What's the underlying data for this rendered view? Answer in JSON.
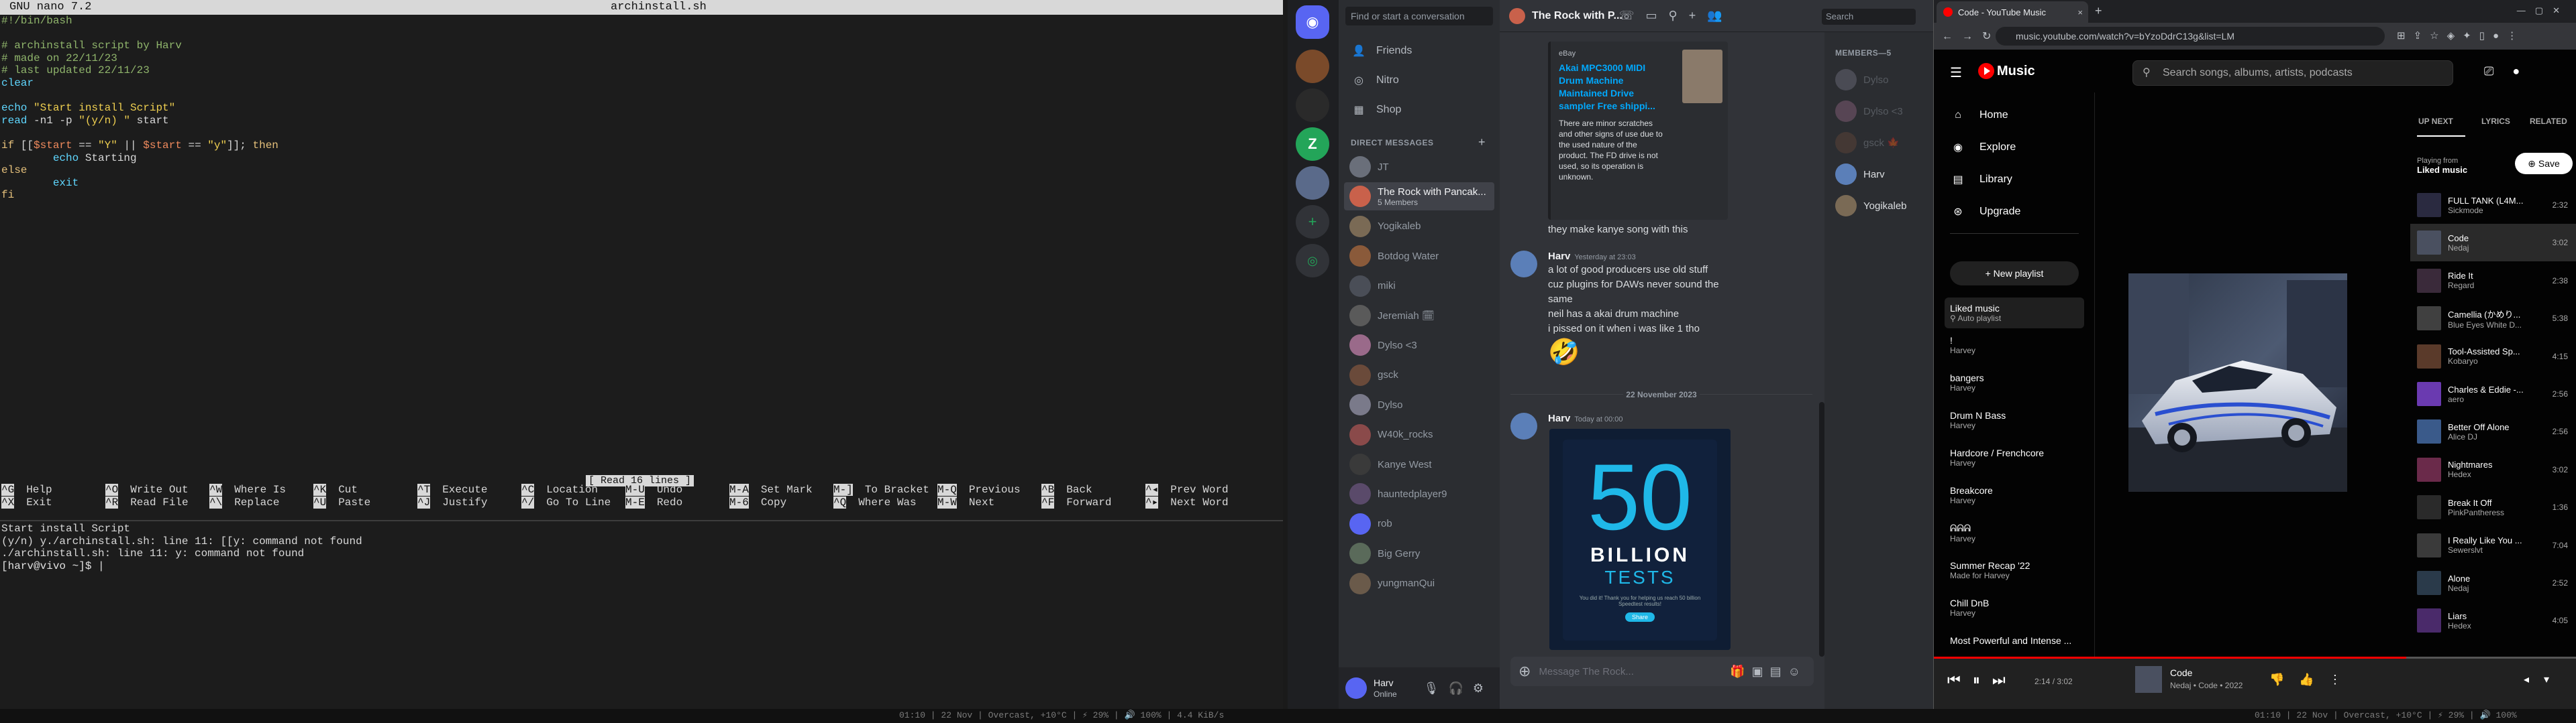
{
  "nano": {
    "version": "GNU nano 7.2",
    "filename": "archinstall.sh",
    "lines": [
      [
        [
          "c-shebang",
          "#!/bin/bash"
        ]
      ],
      [
        [
          "c-plain",
          ""
        ]
      ],
      [
        [
          "c-comment",
          "# archinstall script by Harv"
        ]
      ],
      [
        [
          "c-comment",
          "# made on 22/11/23"
        ]
      ],
      [
        [
          "c-comment",
          "# last updated 22/11/23"
        ]
      ],
      [
        [
          "c-kw",
          "clear"
        ]
      ],
      [
        [
          "c-plain",
          ""
        ]
      ],
      [
        [
          "c-kw",
          "echo "
        ],
        [
          "c-str",
          "\"Start install Script\""
        ]
      ],
      [
        [
          "c-kw",
          "read"
        ],
        [
          "c-plain",
          " -n1 -p "
        ],
        [
          "c-str",
          "\"(y/n) \""
        ],
        [
          "c-plain",
          " start"
        ]
      ],
      [
        [
          "c-plain",
          ""
        ]
      ],
      [
        [
          "c-kw2",
          "if"
        ],
        [
          "c-plain",
          " [["
        ],
        [
          "c-var",
          "$start"
        ],
        [
          "c-plain",
          " == "
        ],
        [
          "c-str",
          "\"Y\""
        ],
        [
          "c-plain",
          " || "
        ],
        [
          "c-var",
          "$start"
        ],
        [
          "c-plain",
          " == "
        ],
        [
          "c-str",
          "\"y\""
        ],
        [
          "c-plain",
          "]]; "
        ],
        [
          "c-kw2",
          "then"
        ]
      ],
      [
        [
          "c-plain",
          "        "
        ],
        [
          "c-kw",
          "echo"
        ],
        [
          "c-plain",
          " Starting"
        ]
      ],
      [
        [
          "c-kw2",
          "else"
        ]
      ],
      [
        [
          "c-plain",
          "        "
        ],
        [
          "c-kw",
          "exit"
        ]
      ],
      [
        [
          "c-kw2",
          "fi"
        ]
      ]
    ],
    "status_message": "[ Read 16 lines ]",
    "help": [
      {
        "key": "^G",
        "label": "Help"
      },
      {
        "key": "^O",
        "label": "Write Out"
      },
      {
        "key": "^W",
        "label": "Where Is"
      },
      {
        "key": "^K",
        "label": "Cut"
      },
      {
        "key": "^T",
        "label": "Execute"
      },
      {
        "key": "^C",
        "label": "Location"
      },
      {
        "key": "M-U",
        "label": "Undo"
      },
      {
        "key": "M-A",
        "label": "Set Mark"
      },
      {
        "key": "M-]",
        "label": "To Bracket"
      },
      {
        "key": "M-Q",
        "label": "Previous"
      },
      {
        "key": "^B",
        "label": "Back"
      },
      {
        "key": "^◂",
        "label": "Prev Word"
      },
      {
        "key": "^X",
        "label": "Exit"
      },
      {
        "key": "^R",
        "label": "Read File"
      },
      {
        "key": "^\\",
        "label": "Replace"
      },
      {
        "key": "^U",
        "label": "Paste"
      },
      {
        "key": "^J",
        "label": "Justify"
      },
      {
        "key": "^/",
        "label": "Go To Line"
      },
      {
        "key": "M-E",
        "label": "Redo"
      },
      {
        "key": "M-6",
        "label": "Copy"
      },
      {
        "key": "^Q",
        "label": "Where Was"
      },
      {
        "key": "M-W",
        "label": "Next"
      },
      {
        "key": "^F",
        "label": "Forward"
      },
      {
        "key": "^▸",
        "label": "Next Word"
      }
    ]
  },
  "shell": {
    "lines": [
      "Start install Script",
      "(y/n) y./archinstall.sh: line 11: [[y: command not found",
      "./archinstall.sh: line 11: y: command not found"
    ],
    "prompt": "[harv@vivo ~]$ |"
  },
  "discord": {
    "search_placeholder": "Find or start a conversation",
    "nav": [
      {
        "icon": "friends-icon",
        "glyph": "👤",
        "label": "Friends"
      },
      {
        "icon": "nitro-icon",
        "glyph": "◎",
        "label": "Nitro"
      },
      {
        "icon": "shop-icon",
        "glyph": "▦",
        "label": "Shop"
      }
    ],
    "dm_header": "DIRECT MESSAGES",
    "dms": [
      {
        "name": "JT",
        "sub": "",
        "color": "#6a6f7a"
      },
      {
        "name": "The Rock with Pancak...",
        "sub": "5 Members",
        "color": "#c9614b",
        "selected": true
      },
      {
        "name": "Yogikaleb",
        "sub": "",
        "color": "#7a6a55"
      },
      {
        "name": "Botdog Water",
        "sub": "",
        "color": "#8a5a3a"
      },
      {
        "name": "miki",
        "sub": "",
        "color": "#4a4e57"
      },
      {
        "name": "Jeremiah 🗓",
        "sub": "",
        "color": "#5a5a5a"
      },
      {
        "name": "Dylso <3",
        "sub": "",
        "color": "#9a6a8a"
      },
      {
        "name": "gsck",
        "sub": "",
        "color": "#6a4a3a"
      },
      {
        "name": "Dylso",
        "sub": "",
        "color": "#7a7a8a"
      },
      {
        "name": "W40k_rocks",
        "sub": "",
        "color": "#8a4a4a"
      },
      {
        "name": "Kanye West",
        "sub": "",
        "color": "#3a3a3a"
      },
      {
        "name": "hauntedplayer9",
        "sub": "",
        "color": "#5a4a6a"
      },
      {
        "name": "rob",
        "sub": "",
        "color": "#5865f2"
      },
      {
        "name": "Big Gerry",
        "sub": "",
        "color": "#5a6a5a"
      },
      {
        "name": "yungmanQui",
        "sub": "",
        "color": "#6a5a4a"
      }
    ],
    "user": {
      "name": "Harv",
      "status": "Online"
    },
    "channel_title": "The Rock with P...",
    "header_search": "Search",
    "embed1": {
      "provider": "eBay",
      "title": "Akai MPC3000 MIDI Drum Machine Maintained Drive sampler Free shippi...",
      "desc": "There are minor scratches and other signs of use due to the used nature of the product. The FD drive is not used, so its operation is unknown."
    },
    "msg_after_embed": "they make kanye song with this",
    "msg1": {
      "author": "Harv",
      "time": "Yesterday at 23:03",
      "lines": [
        "a lot of good producers use old stuff",
        "cuz plugins for DAWs never sound the",
        "same",
        "neil has a akai drum machine",
        "i pissed on it when i was like 1 tho"
      ],
      "emoji": "🤣"
    },
    "date_divider": "22 November 2023",
    "msg2": {
      "author": "Harv",
      "time": "Today at 00:00"
    },
    "tests_card": {
      "big": "50",
      "line1": "BILLION",
      "line2": "TESTS",
      "small": "You did it! Thank you for helping us reach 50 billion Speedtest results!",
      "button": "Share"
    },
    "composer_placeholder": "Message The Rock...",
    "members_header": "MEMBERS—5",
    "members": [
      {
        "name": "Dylso",
        "color": "#7a7a8a",
        "online": false
      },
      {
        "name": "Dylso <3",
        "color": "#9a6a8a",
        "online": false
      },
      {
        "name": "gsck 🍁",
        "color": "#6a4a3a",
        "online": false
      },
      {
        "name": "Harv",
        "color": "#5b7fb8",
        "online": true
      },
      {
        "name": "Yogikaleb",
        "color": "#7a6a55",
        "online": true
      }
    ]
  },
  "browser": {
    "tab_title": "Code - YouTube Music",
    "url": "music.youtube.com/watch?v=bYzoDdrC13g&list=LM"
  },
  "ytm": {
    "brand": "Music",
    "search_placeholder": "Search songs, albums, artists, podcasts",
    "nav": [
      {
        "icon": "home-icon",
        "glyph": "⌂",
        "label": "Home"
      },
      {
        "icon": "explore-icon",
        "glyph": "◉",
        "label": "Explore"
      },
      {
        "icon": "library-icon",
        "glyph": "▤",
        "label": "Library"
      },
      {
        "icon": "upgrade-icon",
        "glyph": "⊛",
        "label": "Upgrade"
      }
    ],
    "new_playlist": "+ New playlist",
    "playlists": [
      {
        "t": "Liked music",
        "s": "⚲ Auto playlist",
        "selected": true
      },
      {
        "t": "!",
        "s": "Harvey"
      },
      {
        "t": "bangers",
        "s": "Harvey"
      },
      {
        "t": "Drum N Bass",
        "s": "Harvey"
      },
      {
        "t": "Hardcore / Frenchcore",
        "s": "Harvey"
      },
      {
        "t": "Breakcore",
        "s": "Harvey"
      },
      {
        "t": "ᕱᕱᕱ",
        "s": "Harvey"
      },
      {
        "t": "Summer Recap '22",
        "s": "Made for Harvey"
      },
      {
        "t": "Chill DnB",
        "s": "Harvey"
      },
      {
        "t": "Most Powerful and Intense ...",
        "s": ""
      }
    ],
    "queue_tabs": [
      "UP NEXT",
      "LYRICS",
      "RELATED"
    ],
    "playing_from_label": "Playing from",
    "playing_from": "Liked music",
    "save_label": "⊕ Save",
    "queue": [
      {
        "t": "FULL TANK (L4M...",
        "a": "Sickmode",
        "d": "2:32",
        "c": "#2a2a40"
      },
      {
        "t": "Code",
        "a": "Nedaj",
        "d": "3:02",
        "c": "#4a5060",
        "current": true
      },
      {
        "t": "Ride It",
        "a": "Regard",
        "d": "2:38",
        "c": "#3a2a3a"
      },
      {
        "t": "Camellia (かめり...",
        "a": "Blue Eyes White D...",
        "d": "5:38",
        "c": "#404040"
      },
      {
        "t": "Tool-Assisted Sp...",
        "a": "Kobaryo",
        "d": "4:15",
        "c": "#5a3a2a"
      },
      {
        "t": "Charles & Eddie -...",
        "a": "aero",
        "d": "2:56",
        "c": "#6a3ab0"
      },
      {
        "t": "Better Off Alone",
        "a": "Alice DJ",
        "d": "2:56",
        "c": "#3a5a8a"
      },
      {
        "t": "Nightmares",
        "a": "Hedex",
        "d": "3:02",
        "c": "#6a2a4a"
      },
      {
        "t": "Break It Off",
        "a": "PinkPantheress",
        "d": "1:36",
        "c": "#2a2a2a"
      },
      {
        "t": "I Really Like You ...",
        "a": "Sewerslvt",
        "d": "7:04",
        "c": "#3a3a3a"
      },
      {
        "t": "Alone",
        "a": "Nedaj",
        "d": "2:52",
        "c": "#2a3a4a"
      },
      {
        "t": "Liars",
        "a": "Hedex",
        "d": "4:05",
        "c": "#4a2a6a"
      }
    ],
    "player": {
      "time": "2:14 / 3:02",
      "progress": 0.736,
      "title": "Code",
      "sub": "Nedaj • Code • 2022"
    }
  },
  "statusbar": {
    "left": "01:10 | 22 Nov | Overcast, +10°C | ⚡ 29% | 🔊 100% | 4.4 KiB/s",
    "vol": "100%",
    "mid": "01:10 | 22 Nov | Overcast, +10°C | ⚡ 29% | 🔊 100% | 4.4 KiB/s",
    "right": "01:10 | 22 Nov | Overcast, +10°C | ⚡ 29% | 🔊 100%"
  }
}
